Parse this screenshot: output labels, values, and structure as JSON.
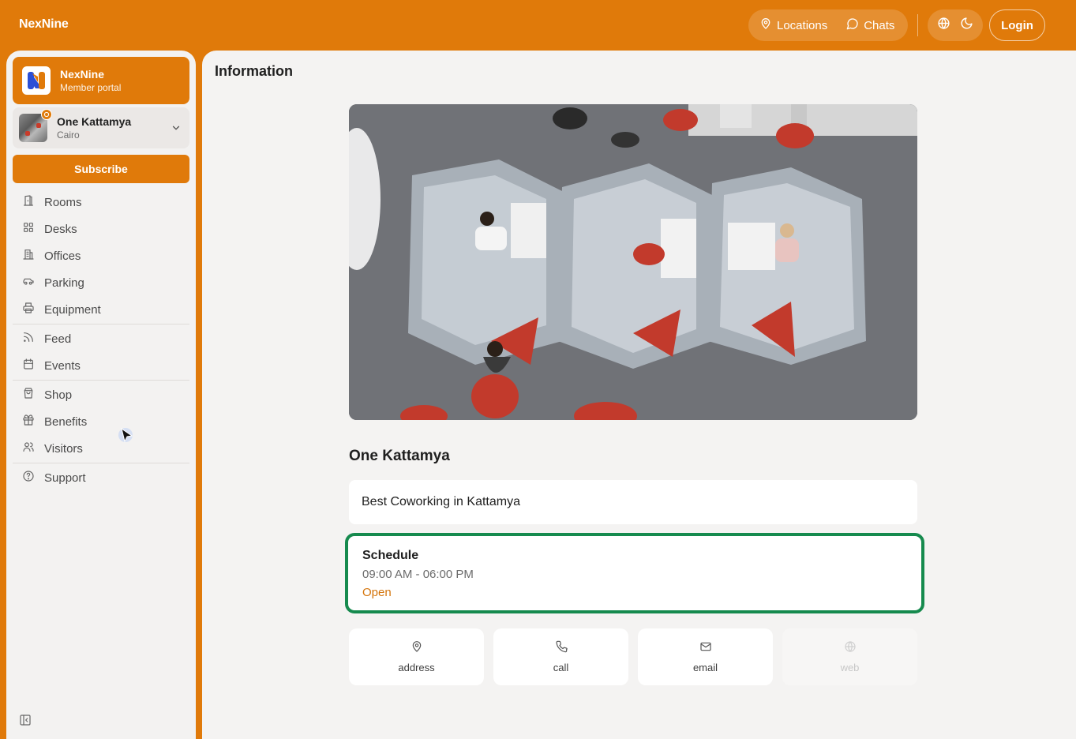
{
  "app": {
    "brand": "NexNine"
  },
  "header": {
    "locations_label": "Locations",
    "chats_label": "Chats",
    "login_label": "Login"
  },
  "sidebar": {
    "org": {
      "name": "NexNine",
      "subtitle": "Member portal"
    },
    "location": {
      "name": "One Kattamya",
      "city": "Cairo"
    },
    "subscribe_label": "Subscribe",
    "items": [
      {
        "label": "Rooms",
        "icon": "door-icon"
      },
      {
        "label": "Desks",
        "icon": "grid-icon"
      },
      {
        "label": "Offices",
        "icon": "building-icon"
      },
      {
        "label": "Parking",
        "icon": "car-icon"
      },
      {
        "label": "Equipment",
        "icon": "printer-icon"
      },
      {
        "label": "Feed",
        "icon": "rss-icon"
      },
      {
        "label": "Events",
        "icon": "calendar-icon"
      },
      {
        "label": "Shop",
        "icon": "shopping-bag-icon"
      },
      {
        "label": "Benefits",
        "icon": "gift-icon"
      },
      {
        "label": "Visitors",
        "icon": "users-icon"
      },
      {
        "label": "Support",
        "icon": "help-circle-icon"
      }
    ]
  },
  "main": {
    "title": "Information",
    "location_name": "One Kattamya",
    "tagline": "Best Coworking in Kattamya",
    "schedule": {
      "title": "Schedule",
      "hours": "09:00 AM - 06:00 PM",
      "status": "Open"
    },
    "contacts": [
      {
        "label": "address",
        "icon": "map-pin-icon",
        "enabled": true
      },
      {
        "label": "call",
        "icon": "phone-icon",
        "enabled": true
      },
      {
        "label": "email",
        "icon": "mail-icon",
        "enabled": true
      },
      {
        "label": "web",
        "icon": "globe-icon",
        "enabled": false
      }
    ]
  },
  "colors": {
    "brand": "#e07a0a",
    "schedule_border": "#168a4e",
    "status_open": "#d4740a"
  }
}
